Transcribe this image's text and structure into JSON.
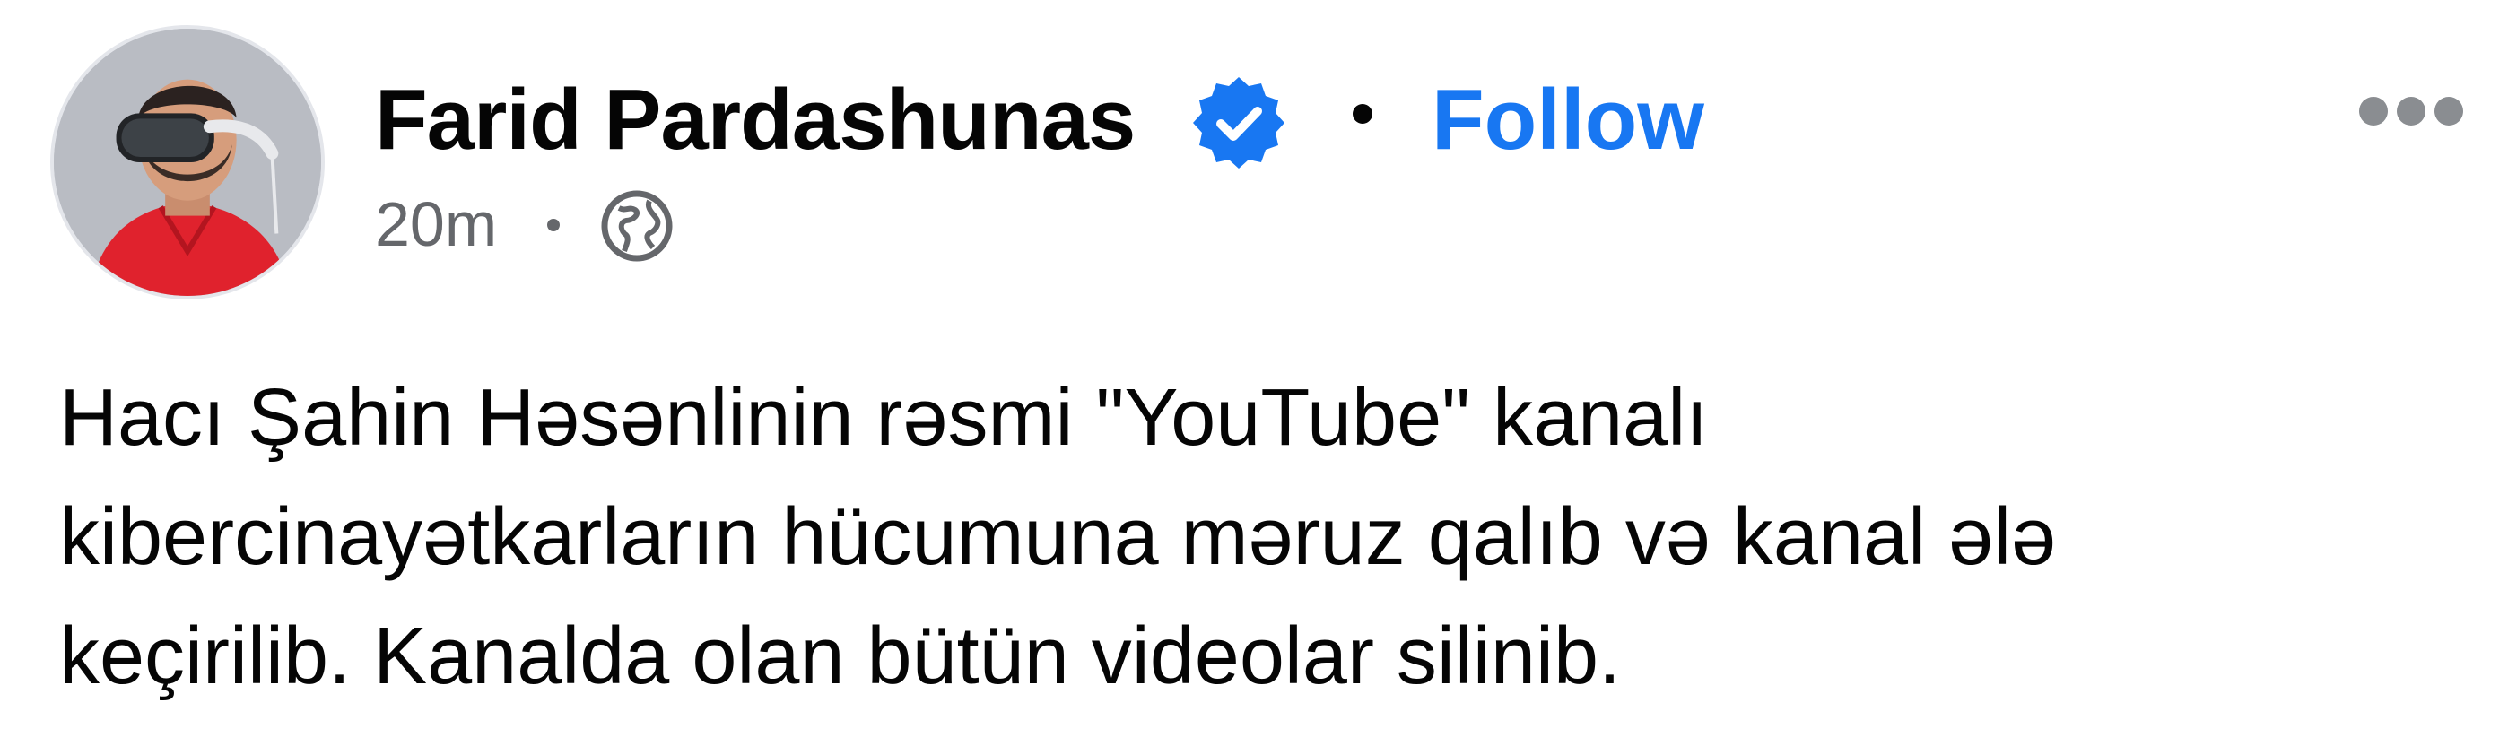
{
  "post": {
    "author": "Farid Pardashunas",
    "follow_label": "Follow",
    "timestamp": "20m",
    "audience_icon": "globe-icon",
    "verified_icon": "verified-badge-icon",
    "more_icon": "more-options-icon",
    "text_lines": [
      "Hacı Şahin Həsənlinin rəsmi \"YouTube\" kanalı",
      "kibercinayətkarların hücumuna məruz qalıb və kanal ələ",
      "keçirilib. Kanalda olan bütün videolar silinib."
    ]
  },
  "colors": {
    "accent": "#1877f2",
    "text_primary": "#050505",
    "text_secondary": "#65676b",
    "icon_gray": "#8a8d91"
  }
}
